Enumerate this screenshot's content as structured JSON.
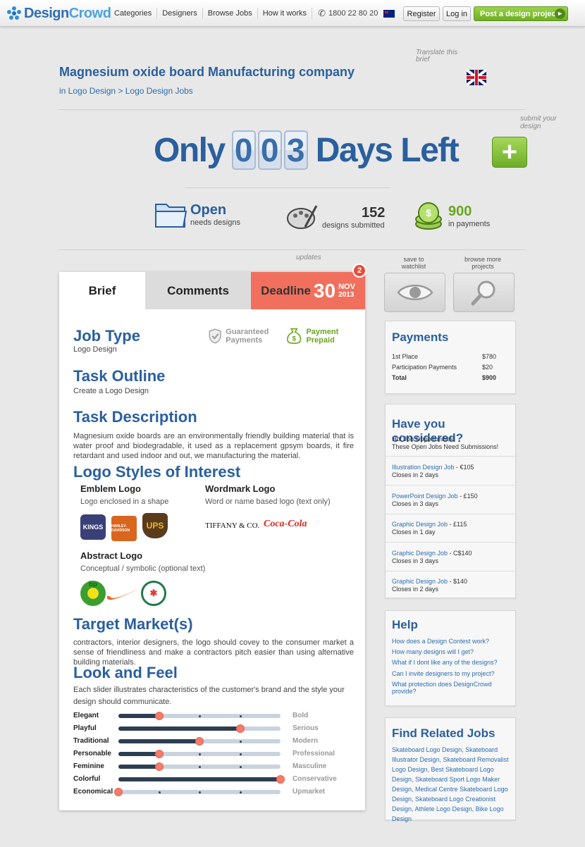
{
  "nav": {
    "brand_a": "Design",
    "brand_b": "Crowd",
    "links": [
      "Categories",
      "Designers",
      "Browse Jobs",
      "How it works"
    ],
    "phone": "1800 22 80 20",
    "register": "Register",
    "login": "Log in",
    "post_project": "Post a design project"
  },
  "header": {
    "title": "Magnesium oxide board Manufacturing company",
    "breadcrumb": "in Logo Design > Logo Design Jobs",
    "translate_note": "Translate this brief"
  },
  "countdown": {
    "prefix": "Only",
    "digits": [
      "0",
      "0",
      "3"
    ],
    "suffix": "Days Left",
    "submit_note": "submit your design",
    "plus": "+"
  },
  "stats": {
    "status_value": "Open",
    "status_label": "needs designs",
    "submitted_value": "152",
    "submitted_label": "designs submitted",
    "payments_value": "900",
    "payments_label": "in payments"
  },
  "tabs": {
    "brief": "Brief",
    "comments": "Comments",
    "deadline_label": "Deadline",
    "deadline_day": "30",
    "deadline_month": "NOV",
    "deadline_year": "2013",
    "updates_count": "2",
    "updates_note": "updates"
  },
  "brief": {
    "job_type_h": "Job Type",
    "job_type": "Logo Design",
    "guaranteed": "Guaranteed Payments",
    "prepaid": "Payment Prepaid",
    "task_outline_h": "Task Outline",
    "task_outline": "Create a Logo Design",
    "task_desc_h": "Task Description",
    "task_desc": "Magnesium oxide boards are an environmentally friendly building material that is water proof and biodegradable, it used as a replacement gpsym boards, it fire retardant and used indoor and out, we manufacturing the material.",
    "styles_h": "Logo Styles of Interest",
    "emblem_h": "Emblem Logo",
    "emblem_t": "Logo enclosed in a shape",
    "wordmark_h": "Wordmark Logo",
    "wordmark_t": "Word or name based logo (text only)",
    "abstract_h": "Abstract Logo",
    "abstract_t": "Conceptual / symbolic (optional text)",
    "example_logos": [
      "KINGS",
      "HARLEY-DAVIDSON",
      "UPS",
      "TIFFANY & CO.",
      "Coca-Cola",
      "bp",
      "Nike",
      "Abstract"
    ],
    "target_h": "Target Market(s)",
    "target": "contractors, interior designers, the logo should covey to the consumer market a sense of friendliness and make a contractors pitch easier than using alternative building materials.",
    "look_h": "Look and Feel",
    "look_t": "Each slider illustrates characteristics of the customer's brand and the style your design should communicate.",
    "sliders": [
      {
        "left": "Elegant",
        "right": "Bold",
        "value": 0.25
      },
      {
        "left": "Playful",
        "right": "Serious",
        "value": 0.75
      },
      {
        "left": "Traditional",
        "right": "Modern",
        "value": 0.5
      },
      {
        "left": "Personable",
        "right": "Professional",
        "value": 0.25
      },
      {
        "left": "Feminine",
        "right": "Masculine",
        "value": 0.25
      },
      {
        "left": "Colorful",
        "right": "Conservative",
        "value": 1.0
      },
      {
        "left": "Economical",
        "right": "Upmarket",
        "value": 0.0
      }
    ]
  },
  "sidebar": {
    "watchlist_label": "save to watchlist",
    "browse_label": "browse more projects",
    "payments_h": "Payments",
    "payments": [
      {
        "label": "1st Place",
        "amount": "$780"
      },
      {
        "label": "Participation Payments",
        "amount": "$20"
      },
      {
        "label": "Total",
        "amount": "$900"
      }
    ],
    "consider_h": "Have you considered?",
    "consider_intro_1": "Hot Job Opportunities!",
    "consider_intro_2": "These Open Jobs Need Submissions!",
    "consider_jobs": [
      {
        "link": "Illustration Design Job",
        "price": " - €105",
        "closes": "Closes in 2 days"
      },
      {
        "link": "PowerPoint Design Job",
        "price": " - £150",
        "closes": "Closes in 3 days"
      },
      {
        "link": "Graphic Design Job",
        "price": " - £115",
        "closes": "Closes in 1 day"
      },
      {
        "link": "Graphic Design Job",
        "price": " - C$140",
        "closes": "Closes in 3 days"
      },
      {
        "link": "Graphic Design Job",
        "price": " - $140",
        "closes": "Closes in 2 days"
      }
    ],
    "help_h": "Help",
    "help_links": [
      "How does a Design Contest work?",
      "How many designs will I get?",
      "What if I dont like any of the designs?",
      "Can I invite designers to my project?",
      "What protection does DesignCrowd provide?"
    ],
    "related_h": "Find Related Jobs",
    "related_text": "Skateboard Logo Design, Skateboard Illustrator Design, Skateboard Removalist Logo Design, Best Skateboard Logo Design, Skateboard Sport Logo Maker Design, Medical Centre Skateboard Logo Design, Skateboard Logo Creationist Design, Athlete Logo Design, Bike Logo Design"
  }
}
